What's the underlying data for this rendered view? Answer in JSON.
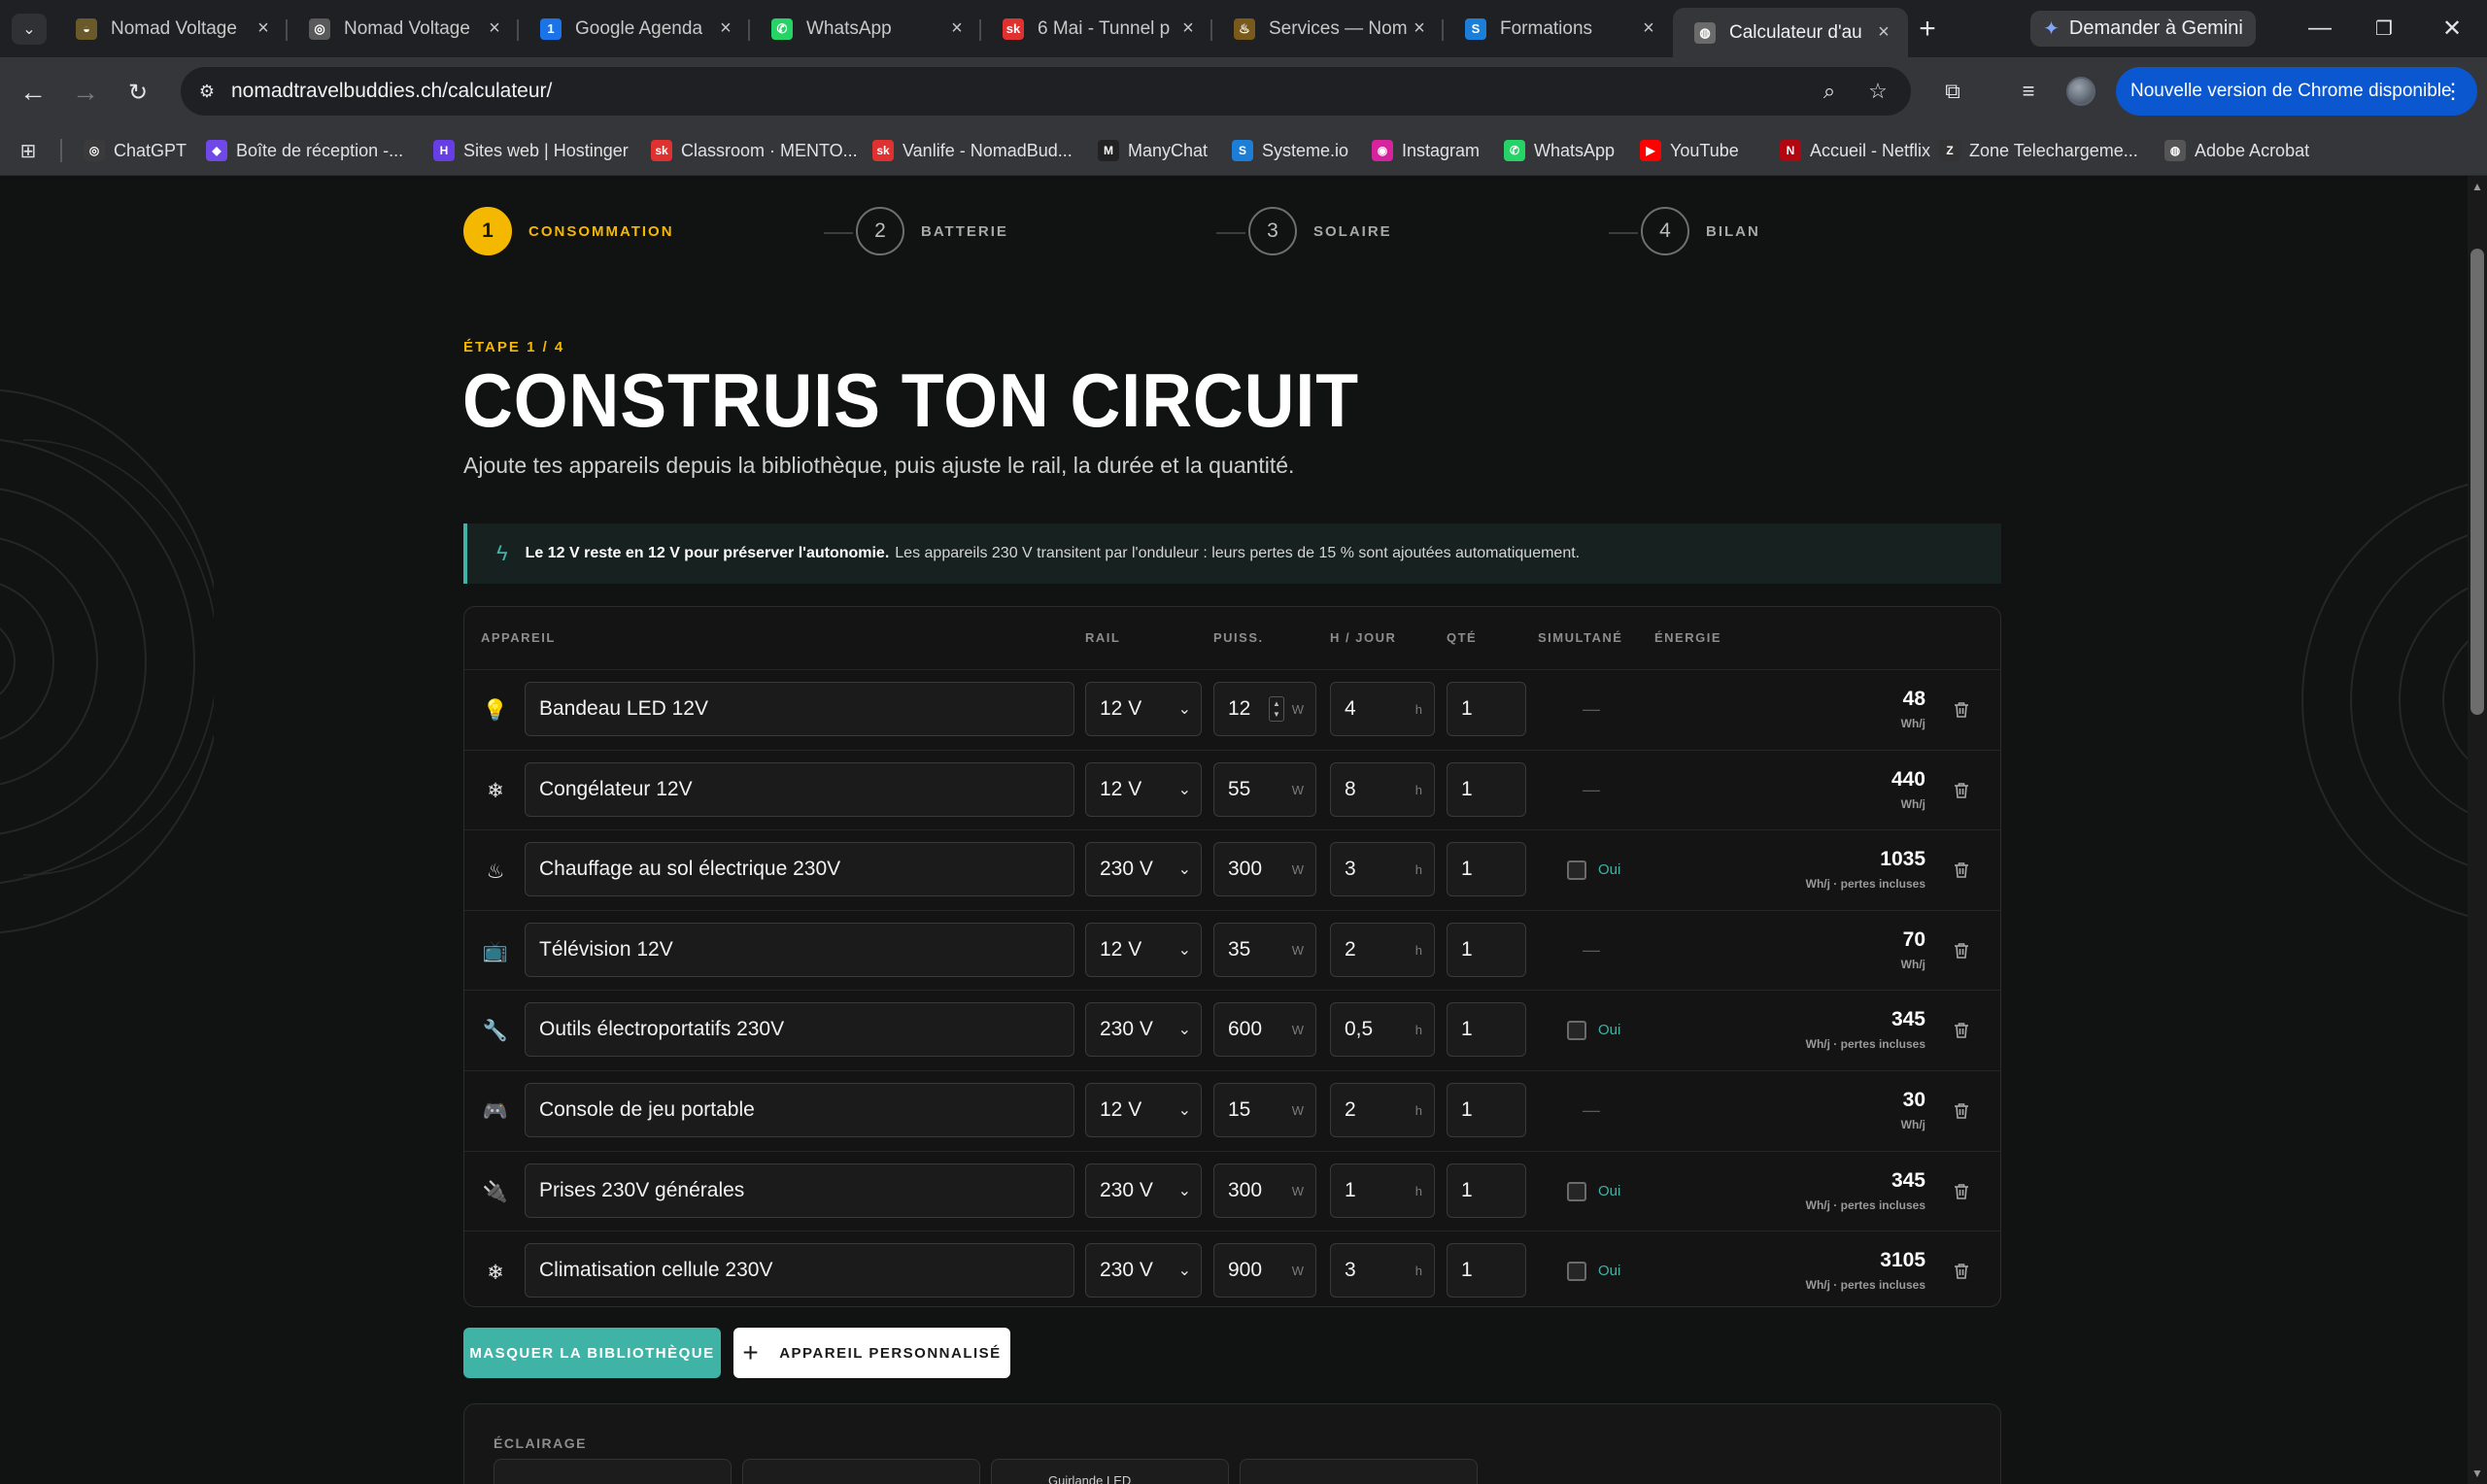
{
  "browser": {
    "tabs": [
      {
        "label": "Nomad Voltage",
        "fav_color": "#6a5a2a",
        "fav_glyph": "◒"
      },
      {
        "label": "Nomad Voltage",
        "fav_color": "#5a5a5a",
        "fav_glyph": "◎"
      },
      {
        "label": "Google Agenda",
        "fav_color": "#1a73e8",
        "fav_glyph": "1"
      },
      {
        "label": "WhatsApp",
        "fav_color": "#25d366",
        "fav_glyph": "✆"
      },
      {
        "label": "6 Mai - Tunnel p",
        "fav_color": "#e03131",
        "fav_glyph": "sk"
      },
      {
        "label": "Services — Nom",
        "fav_color": "#7a5a1a",
        "fav_glyph": "♨"
      },
      {
        "label": "Formations",
        "fav_color": "#1c7ed6",
        "fav_glyph": "S"
      },
      {
        "label": "Calculateur d'au",
        "fav_color": "#6b6b6b",
        "fav_glyph": "◍"
      }
    ],
    "gemini_label": "Demander à Gemini",
    "url": "nomadtravelbuddies.ch/calculateur/",
    "update_label": "Nouvelle version de Chrome disponible",
    "bookmarks": [
      {
        "label": "ChatGPT",
        "fav_color": "#3a3a3a",
        "fav_glyph": "◎"
      },
      {
        "label": "Boîte de réception -...",
        "fav_color": "#7048e8",
        "fav_glyph": "◆"
      },
      {
        "label": "Sites web | Hostinger",
        "fav_color": "#673de6",
        "fav_glyph": "H"
      },
      {
        "label": "Classroom · MENTO...",
        "fav_color": "#e03131",
        "fav_glyph": "sk"
      },
      {
        "label": "Vanlife - NomadBud...",
        "fav_color": "#e03131",
        "fav_glyph": "sk"
      },
      {
        "label": "ManyChat",
        "fav_color": "#222222",
        "fav_glyph": "M"
      },
      {
        "label": "Systeme.io",
        "fav_color": "#1c7ed6",
        "fav_glyph": "S"
      },
      {
        "label": "Instagram",
        "fav_color": "#d6249f",
        "fav_glyph": "◉"
      },
      {
        "label": "WhatsApp",
        "fav_color": "#25d366",
        "fav_glyph": "✆"
      },
      {
        "label": "YouTube",
        "fav_color": "#ff0000",
        "fav_glyph": "▶"
      },
      {
        "label": "Accueil - Netflix",
        "fav_color": "#b20710",
        "fav_glyph": "N"
      },
      {
        "label": "Zone Telechargeme...",
        "fav_color": "#333333",
        "fav_glyph": "Z"
      },
      {
        "label": "Adobe Acrobat",
        "fav_color": "#555555",
        "fav_glyph": "◍"
      }
    ]
  },
  "page": {
    "steps": [
      {
        "num": "1",
        "label": "CONSOMMATION",
        "active": true
      },
      {
        "num": "2",
        "label": "BATTERIE",
        "active": false
      },
      {
        "num": "3",
        "label": "SOLAIRE",
        "active": false
      },
      {
        "num": "4",
        "label": "BILAN",
        "active": false
      }
    ],
    "kicker": "ÉTAPE 1 / 4",
    "title": "CONSTRUIS TON CIRCUIT",
    "subtitle": "Ajoute tes appareils depuis la bibliothèque, puis ajuste le rail, la durée et la quantité.",
    "info_bold": "Le 12 V reste en 12 V pour préserver l'autonomie.",
    "info_text": "Les appareils 230 V transitent par l'onduleur : leurs pertes de 15 % sont ajoutées automatiquement.",
    "headers": {
      "device": "APPAREIL",
      "rail": "RAIL",
      "power": "PUISS.",
      "hours": "H / JOUR",
      "qty": "QTÉ",
      "simul": "SIMULTANÉ",
      "energy": "ÉNERGIE"
    },
    "units": {
      "w": "W",
      "h": "h",
      "dash": "—",
      "oui": "Oui"
    },
    "devices": [
      {
        "icon": "💡",
        "icon_name": "lightbulb-icon",
        "name": "Bandeau LED 12V",
        "rail": "12 V",
        "power": "12",
        "hours": "4",
        "qty": "1",
        "simul": false,
        "energy": "48",
        "energy_unit": "Wh/j"
      },
      {
        "icon": "❄",
        "icon_name": "snowflake-icon",
        "name": "Congélateur 12V",
        "rail": "12 V",
        "power": "55",
        "hours": "8",
        "qty": "1",
        "simul": false,
        "energy": "440",
        "energy_unit": "Wh/j"
      },
      {
        "icon": "♨",
        "icon_name": "heat-icon",
        "name": "Chauffage au sol électrique 230V",
        "rail": "230 V",
        "power": "300",
        "hours": "3",
        "qty": "1",
        "simul": true,
        "energy": "1035",
        "energy_unit": "Wh/j · pertes incluses"
      },
      {
        "icon": "📺",
        "icon_name": "tv-icon",
        "name": "Télévision 12V",
        "rail": "12 V",
        "power": "35",
        "hours": "2",
        "qty": "1",
        "simul": false,
        "energy": "70",
        "energy_unit": "Wh/j"
      },
      {
        "icon": "🔧",
        "icon_name": "wrench-icon",
        "name": "Outils électroportatifs 230V",
        "rail": "230 V",
        "power": "600",
        "hours": "0,5",
        "qty": "1",
        "simul": true,
        "energy": "345",
        "energy_unit": "Wh/j · pertes incluses"
      },
      {
        "icon": "🎮",
        "icon_name": "gamepad-icon",
        "name": "Console de jeu portable",
        "rail": "12 V",
        "power": "15",
        "hours": "2",
        "qty": "1",
        "simul": false,
        "energy": "30",
        "energy_unit": "Wh/j"
      },
      {
        "icon": "🔌",
        "icon_name": "plug-icon",
        "name": "Prises 230V générales",
        "rail": "230 V",
        "power": "300",
        "hours": "1",
        "qty": "1",
        "simul": true,
        "energy": "345",
        "energy_unit": "Wh/j · pertes incluses"
      },
      {
        "icon": "❄",
        "icon_name": "snowflake-icon",
        "name": "Climatisation cellule 230V",
        "rail": "230 V",
        "power": "900",
        "hours": "3",
        "qty": "1",
        "simul": true,
        "energy": "3105",
        "energy_unit": "Wh/j · pertes incluses"
      }
    ],
    "btn_library": "MASQUER LA BIBLIOTHÈQUE",
    "btn_custom": "APPAREIL PERSONNALISÉ",
    "library_category": "ÉCLAIRAGE",
    "library_tile_partial": "Guirlande LED",
    "colors": {
      "accent_yellow": "#f5b800",
      "accent_teal": "#3fb3a6",
      "background": "#111212"
    }
  }
}
